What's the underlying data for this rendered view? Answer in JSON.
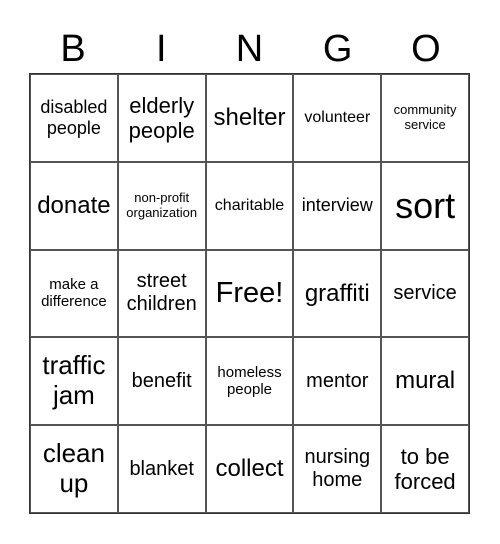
{
  "header": [
    "B",
    "I",
    "N",
    "G",
    "O"
  ],
  "cells": [
    [
      "disabled people",
      "elderly people",
      "shelter",
      "volunteer",
      "community service"
    ],
    [
      "donate",
      "non-profit organization",
      "charitable",
      "interview",
      "sort"
    ],
    [
      "make a difference",
      "street children",
      "Free!",
      "graffiti",
      "service"
    ],
    [
      "traffic jam",
      "benefit",
      "homeless people",
      "mentor",
      "mural"
    ],
    [
      "clean up",
      "blanket",
      "collect",
      "nursing home",
      "to be forced"
    ]
  ]
}
